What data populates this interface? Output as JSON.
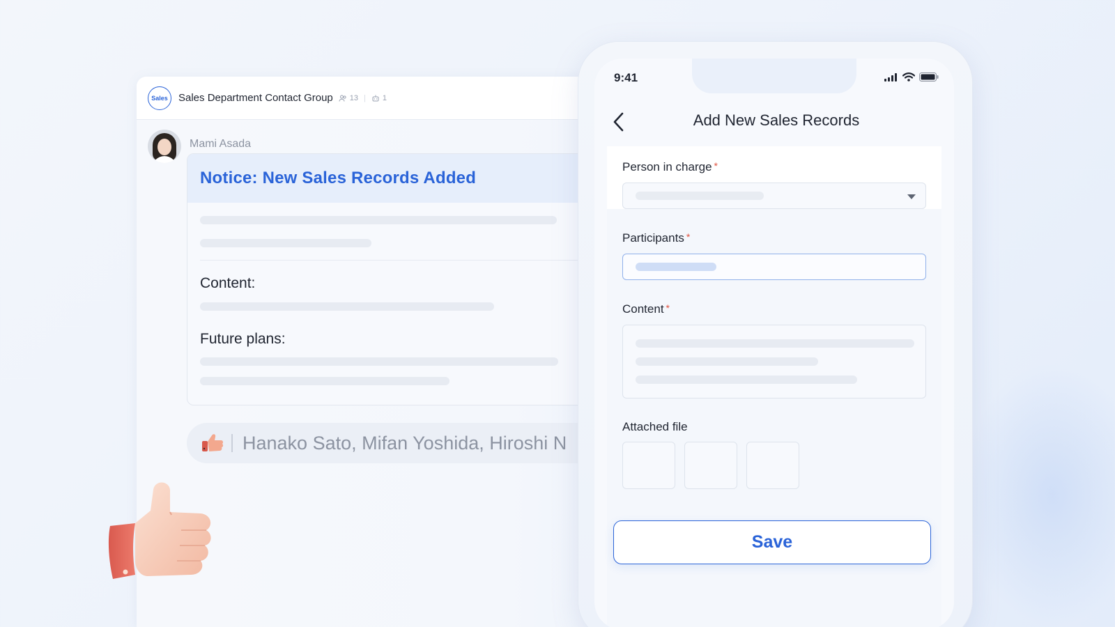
{
  "chat": {
    "group_logo_text": "Sales",
    "group_name": "Sales Department Contact Group",
    "member_count": "13",
    "bot_count": "1",
    "sender_name": "Mami Asada",
    "message": {
      "title": "Notice: New Sales Records Added",
      "content_label": "Content:",
      "future_plans_label": "Future plans:"
    },
    "reactions": {
      "emoji": "thumbs-up-icon",
      "names": "Hanako Sato, Mifan Yoshida, Hiroshi N"
    }
  },
  "phone": {
    "status_time": "9:41",
    "nav_title": "Add New Sales Records",
    "fields": {
      "person_in_charge": {
        "label": "Person in charge",
        "required": "*"
      },
      "participants": {
        "label": "Participants",
        "required": "*"
      },
      "content": {
        "label": "Content",
        "required": "*"
      },
      "attached_file": {
        "label": "Attached file"
      }
    },
    "save_label": "Save"
  },
  "colors": {
    "accent": "#2a63d8",
    "required": "#e0513f",
    "background": "#eef3fb"
  }
}
